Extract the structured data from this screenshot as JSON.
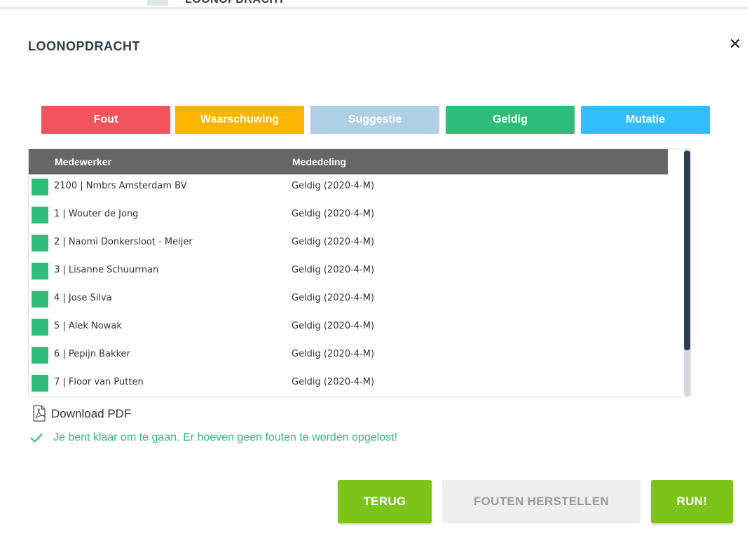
{
  "background": {
    "title": "LOONOPDRACHT"
  },
  "dialog": {
    "title": "LOONOPDRACHT",
    "close_glyph": "✕"
  },
  "legend": [
    {
      "label": "Fout",
      "color": "#f2545b"
    },
    {
      "label": "Waarschuwing",
      "color": "#ffb400"
    },
    {
      "label": "Suggestie",
      "color": "#aecfe4"
    },
    {
      "label": "Geldig",
      "color": "#2fbe7a"
    },
    {
      "label": "Mutatie",
      "color": "#33bfff"
    }
  ],
  "table": {
    "headers": {
      "employee": "Medewerker",
      "message": "Mededeling"
    },
    "status_color": "#2fbe7a",
    "rows": [
      {
        "employee": "2100 | Nmbrs Amsterdam BV",
        "message": "Geldig (2020-4-M)"
      },
      {
        "employee": "1 | Wouter de Jong",
        "message": "Geldig (2020-4-M)"
      },
      {
        "employee": "2 | Naomi Donkersloot - Meijer",
        "message": "Geldig (2020-4-M)"
      },
      {
        "employee": "3 | Lisanne Schuurman",
        "message": "Geldig (2020-4-M)"
      },
      {
        "employee": "4 | Jose Silva",
        "message": "Geldig (2020-4-M)"
      },
      {
        "employee": "5 | Alek Nowak",
        "message": "Geldig (2020-4-M)"
      },
      {
        "employee": "6 | Pepijn Bakker",
        "message": "Geldig (2020-4-M)"
      },
      {
        "employee": "7 | Floor van Putten",
        "message": "Geldig (2020-4-M)"
      }
    ]
  },
  "download": {
    "label": "Download PDF",
    "icon": "pdf-icon"
  },
  "status": {
    "message": "Je bent klaar om te gaan. Er hoeven geen fouten te worden opgelost!",
    "icon": "checkmark-icon"
  },
  "buttons": {
    "back": "TERUG",
    "fix_errors": "FOUTEN HERSTELLEN",
    "run": "RUN!"
  }
}
